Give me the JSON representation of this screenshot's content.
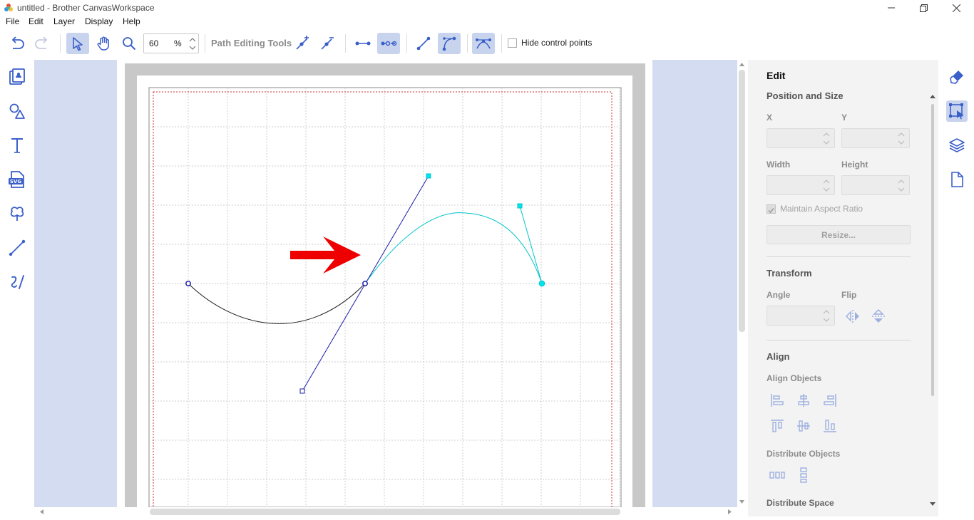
{
  "window": {
    "title": "untitled - Brother CanvasWorkspace",
    "controls": [
      "minimize-icon",
      "restore-icon",
      "close-icon"
    ]
  },
  "menu": [
    "File",
    "Edit",
    "Layer",
    "Display",
    "Help"
  ],
  "toolbar": {
    "zoom_value": "60",
    "zoom_unit": "%",
    "path_tools_label": "Path Editing Tools",
    "hide_control_points_label": "Hide control points",
    "hide_control_points_checked": false,
    "icons": [
      "undo-icon",
      "redo-icon",
      "select-icon",
      "hand-icon",
      "zoom-icon",
      "add-node-icon",
      "delete-node-icon",
      "join-nodes-icon",
      "split-nodes-icon",
      "line-segment-icon",
      "curve-segment-icon",
      "smooth-node-icon"
    ]
  },
  "left_tools": [
    "project-icon",
    "shapes-icon",
    "text-icon",
    "svg-icon",
    "clover-shape-icon",
    "line-icon",
    "freehand-icon"
  ],
  "edit_panel": {
    "title": "Edit",
    "position_size": {
      "heading": "Position and Size",
      "x_label": "X",
      "y_label": "Y",
      "width_label": "Width",
      "height_label": "Height",
      "aspect_label": "Maintain Aspect Ratio",
      "aspect_checked": true,
      "resize_label": "Resize..."
    },
    "transform": {
      "heading": "Transform",
      "angle_label": "Angle",
      "flip_label": "Flip"
    },
    "align": {
      "heading": "Align",
      "objects_label": "Align Objects",
      "distribute_objects_label": "Distribute Objects",
      "distribute_space_label": "Distribute Space"
    }
  },
  "side_tabs": [
    "paint-brush-icon",
    "edit-select-icon",
    "layers-icon",
    "page-icon"
  ],
  "colors": {
    "accent": "#3a5fc8",
    "workspace_bg": "#d3dcf0",
    "active_tool_bg": "#c8d4ee",
    "selected_segment": "#00c5c9",
    "handle_line": "#1c1caa",
    "arrow": "#ee0000",
    "cutting_border": "#d03030"
  }
}
